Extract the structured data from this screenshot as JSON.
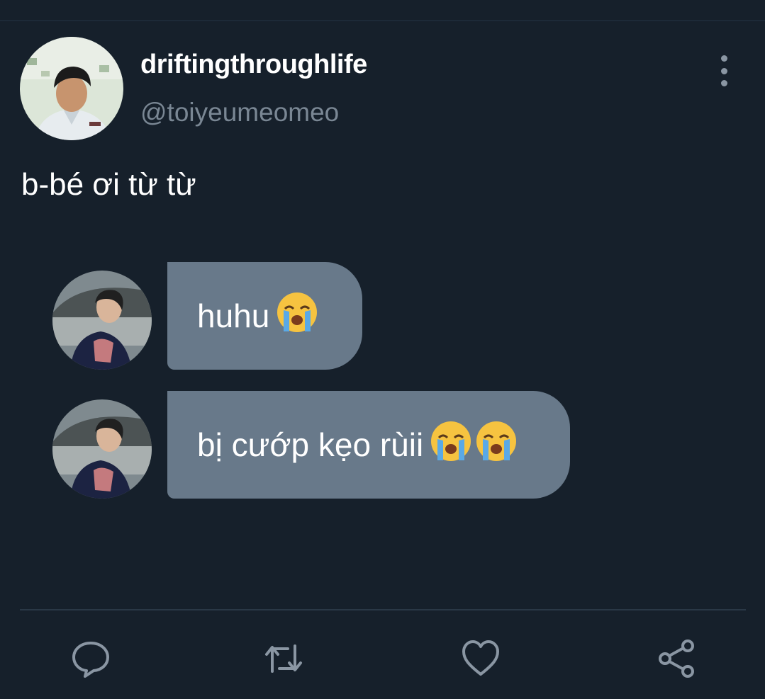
{
  "tweet": {
    "display_name": "driftingthroughlife",
    "handle": "@toiyeumeomeo",
    "text": "b-bé ơi từ từ"
  },
  "chat": {
    "messages": [
      {
        "text": "huhu",
        "emoji": "loudly-crying-face",
        "emoji_count": 1
      },
      {
        "text": "bị cướp kẹo rùii",
        "emoji": "loudly-crying-face",
        "emoji_count": 2
      }
    ]
  },
  "actions": [
    {
      "name": "reply",
      "icon": "reply-icon"
    },
    {
      "name": "retweet",
      "icon": "retweet-icon"
    },
    {
      "name": "like",
      "icon": "heart-icon"
    },
    {
      "name": "share",
      "icon": "share-icon"
    }
  ],
  "colors": {
    "background": "#16202b",
    "bubble": "#68798a",
    "icon": "#8a96a3",
    "secondary_text": "#7a8794"
  }
}
